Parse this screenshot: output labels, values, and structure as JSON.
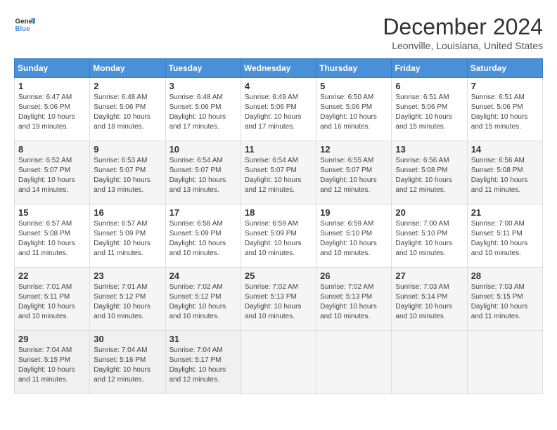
{
  "header": {
    "logo_line1": "General",
    "logo_line2": "Blue",
    "month_title": "December 2024",
    "location": "Leonville, Louisiana, United States"
  },
  "calendar": {
    "days_of_week": [
      "Sunday",
      "Monday",
      "Tuesday",
      "Wednesday",
      "Thursday",
      "Friday",
      "Saturday"
    ],
    "weeks": [
      [
        {
          "day": "",
          "info": ""
        },
        {
          "day": "2",
          "info": "Sunrise: 6:48 AM\nSunset: 5:06 PM\nDaylight: 10 hours\nand 18 minutes."
        },
        {
          "day": "3",
          "info": "Sunrise: 6:48 AM\nSunset: 5:06 PM\nDaylight: 10 hours\nand 17 minutes."
        },
        {
          "day": "4",
          "info": "Sunrise: 6:49 AM\nSunset: 5:06 PM\nDaylight: 10 hours\nand 17 minutes."
        },
        {
          "day": "5",
          "info": "Sunrise: 6:50 AM\nSunset: 5:06 PM\nDaylight: 10 hours\nand 16 minutes."
        },
        {
          "day": "6",
          "info": "Sunrise: 6:51 AM\nSunset: 5:06 PM\nDaylight: 10 hours\nand 15 minutes."
        },
        {
          "day": "7",
          "info": "Sunrise: 6:51 AM\nSunset: 5:06 PM\nDaylight: 10 hours\nand 15 minutes."
        }
      ],
      [
        {
          "day": "1",
          "info": "Sunrise: 6:47 AM\nSunset: 5:06 PM\nDaylight: 10 hours\nand 19 minutes."
        },
        {
          "day": "8",
          "info": "Sunrise: 6:52 AM\nSunset: 5:07 PM\nDaylight: 10 hours\nand 14 minutes."
        },
        {
          "day": "9",
          "info": "Sunrise: 6:53 AM\nSunset: 5:07 PM\nDaylight: 10 hours\nand 13 minutes."
        },
        {
          "day": "10",
          "info": "Sunrise: 6:54 AM\nSunset: 5:07 PM\nDaylight: 10 hours\nand 13 minutes."
        },
        {
          "day": "11",
          "info": "Sunrise: 6:54 AM\nSunset: 5:07 PM\nDaylight: 10 hours\nand 12 minutes."
        },
        {
          "day": "12",
          "info": "Sunrise: 6:55 AM\nSunset: 5:07 PM\nDaylight: 10 hours\nand 12 minutes."
        },
        {
          "day": "13",
          "info": "Sunrise: 6:56 AM\nSunset: 5:08 PM\nDaylight: 10 hours\nand 12 minutes."
        },
        {
          "day": "14",
          "info": "Sunrise: 6:56 AM\nSunset: 5:08 PM\nDaylight: 10 hours\nand 11 minutes."
        }
      ],
      [
        {
          "day": "15",
          "info": "Sunrise: 6:57 AM\nSunset: 5:08 PM\nDaylight: 10 hours\nand 11 minutes."
        },
        {
          "day": "16",
          "info": "Sunrise: 6:57 AM\nSunset: 5:09 PM\nDaylight: 10 hours\nand 11 minutes."
        },
        {
          "day": "17",
          "info": "Sunrise: 6:58 AM\nSunset: 5:09 PM\nDaylight: 10 hours\nand 10 minutes."
        },
        {
          "day": "18",
          "info": "Sunrise: 6:59 AM\nSunset: 5:09 PM\nDaylight: 10 hours\nand 10 minutes."
        },
        {
          "day": "19",
          "info": "Sunrise: 6:59 AM\nSunset: 5:10 PM\nDaylight: 10 hours\nand 10 minutes."
        },
        {
          "day": "20",
          "info": "Sunrise: 7:00 AM\nSunset: 5:10 PM\nDaylight: 10 hours\nand 10 minutes."
        },
        {
          "day": "21",
          "info": "Sunrise: 7:00 AM\nSunset: 5:11 PM\nDaylight: 10 hours\nand 10 minutes."
        }
      ],
      [
        {
          "day": "22",
          "info": "Sunrise: 7:01 AM\nSunset: 5:11 PM\nDaylight: 10 hours\nand 10 minutes."
        },
        {
          "day": "23",
          "info": "Sunrise: 7:01 AM\nSunset: 5:12 PM\nDaylight: 10 hours\nand 10 minutes."
        },
        {
          "day": "24",
          "info": "Sunrise: 7:02 AM\nSunset: 5:12 PM\nDaylight: 10 hours\nand 10 minutes."
        },
        {
          "day": "25",
          "info": "Sunrise: 7:02 AM\nSunset: 5:13 PM\nDaylight: 10 hours\nand 10 minutes."
        },
        {
          "day": "26",
          "info": "Sunrise: 7:02 AM\nSunset: 5:13 PM\nDaylight: 10 hours\nand 10 minutes."
        },
        {
          "day": "27",
          "info": "Sunrise: 7:03 AM\nSunset: 5:14 PM\nDaylight: 10 hours\nand 10 minutes."
        },
        {
          "day": "28",
          "info": "Sunrise: 7:03 AM\nSunset: 5:15 PM\nDaylight: 10 hours\nand 11 minutes."
        }
      ],
      [
        {
          "day": "29",
          "info": "Sunrise: 7:04 AM\nSunset: 5:15 PM\nDaylight: 10 hours\nand 11 minutes."
        },
        {
          "day": "30",
          "info": "Sunrise: 7:04 AM\nSunset: 5:16 PM\nDaylight: 10 hours\nand 12 minutes."
        },
        {
          "day": "31",
          "info": "Sunrise: 7:04 AM\nSunset: 5:17 PM\nDaylight: 10 hours\nand 12 minutes."
        },
        {
          "day": "",
          "info": ""
        },
        {
          "day": "",
          "info": ""
        },
        {
          "day": "",
          "info": ""
        },
        {
          "day": "",
          "info": ""
        }
      ]
    ]
  }
}
